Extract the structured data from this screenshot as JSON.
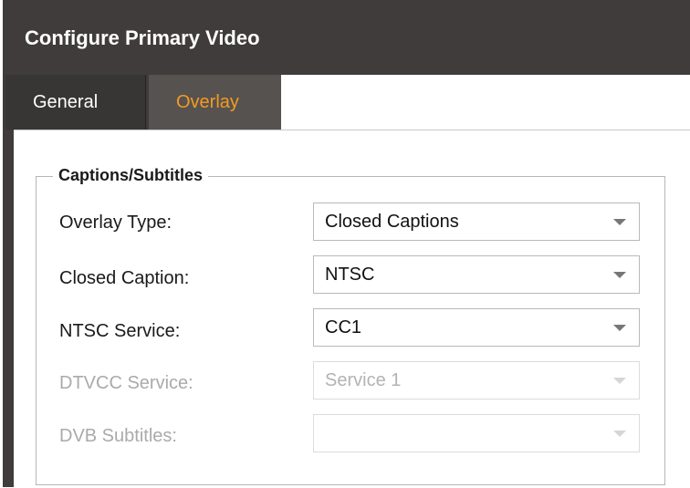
{
  "dialog": {
    "title": "Configure Primary Video"
  },
  "tabs": [
    {
      "label": "General",
      "active": false
    },
    {
      "label": "Overlay",
      "active": true
    }
  ],
  "captions": {
    "legend": "Captions/Subtitles",
    "rows": [
      {
        "label": "Overlay Type:",
        "value": "Closed Captions",
        "enabled": true
      },
      {
        "label": "Closed Caption:",
        "value": "NTSC",
        "enabled": true
      },
      {
        "label": "NTSC Service:",
        "value": "CC1",
        "enabled": true
      },
      {
        "label": "DTVCC Service:",
        "value": "Service 1",
        "enabled": false
      },
      {
        "label": "DVB Subtitles:",
        "value": "",
        "enabled": false
      }
    ]
  },
  "colors": {
    "header_bg": "#3f3c3b",
    "tab_active_bg": "#56524f",
    "tab_active_text": "#f39a24",
    "disabled_text": "#aaaaaa"
  }
}
